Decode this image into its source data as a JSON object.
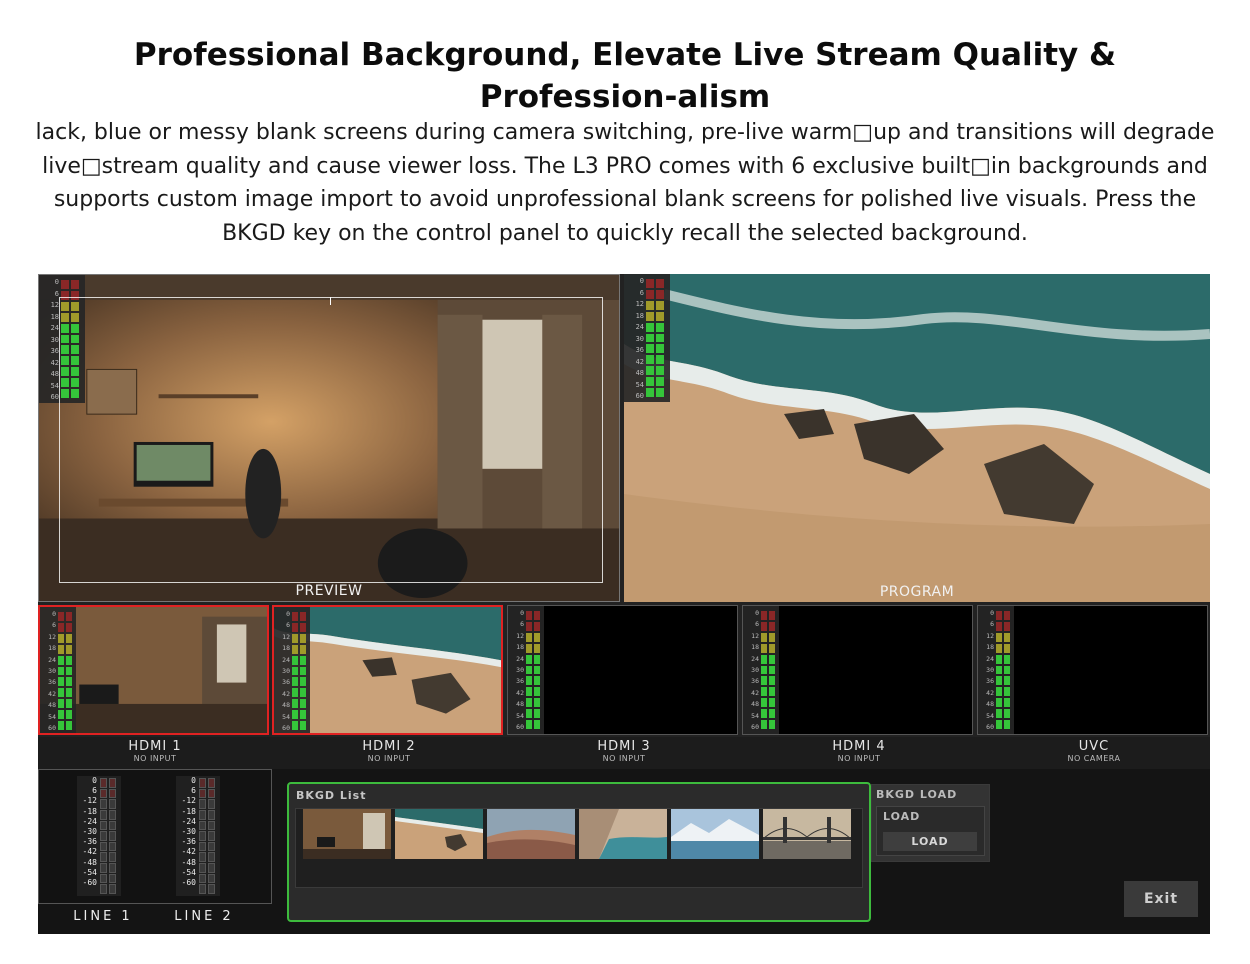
{
  "headline": "Professional Background, Elevate Live Stream Quality & Profession-alism",
  "body": "lack, blue or messy blank screens during camera switching, pre-live warm□up and transitions will degrade live□stream quality and cause viewer loss. The L3 PRO comes with 6 exclusive built□in backgrounds and supports custom image import to avoid unprofessional blank screens for polished live visuals. Press the BKGD key on the control panel to quickly recall the selected background.",
  "app": {
    "meter_scale": [
      "0",
      "6",
      "12",
      "18",
      "24",
      "30",
      "36",
      "42",
      "48",
      "54",
      "60"
    ],
    "preview_label": "PREVIEW",
    "program_label": "PROGRAM",
    "channels": [
      {
        "name": "HDMI 1",
        "sub": "NO INPUT"
      },
      {
        "name": "HDMI 2",
        "sub": "NO INPUT"
      },
      {
        "name": "HDMI 3",
        "sub": "NO INPUT"
      },
      {
        "name": "HDMI 4",
        "sub": "NO INPUT"
      },
      {
        "name": "UVC",
        "sub": "NO CAMERA"
      }
    ],
    "audio": {
      "scale": [
        "0",
        "6",
        "-12",
        "-18",
        "-24",
        "-30",
        "-36",
        "-42",
        "-48",
        "-54",
        "-60"
      ],
      "lines": [
        "LINE 1",
        "LINE 2"
      ]
    },
    "bkgd_list_title": "BKGD List",
    "bkgd_load_title": "BKGD LOAD",
    "load_label": "LOAD",
    "load_button": "LOAD",
    "exit_button": "Exit"
  }
}
